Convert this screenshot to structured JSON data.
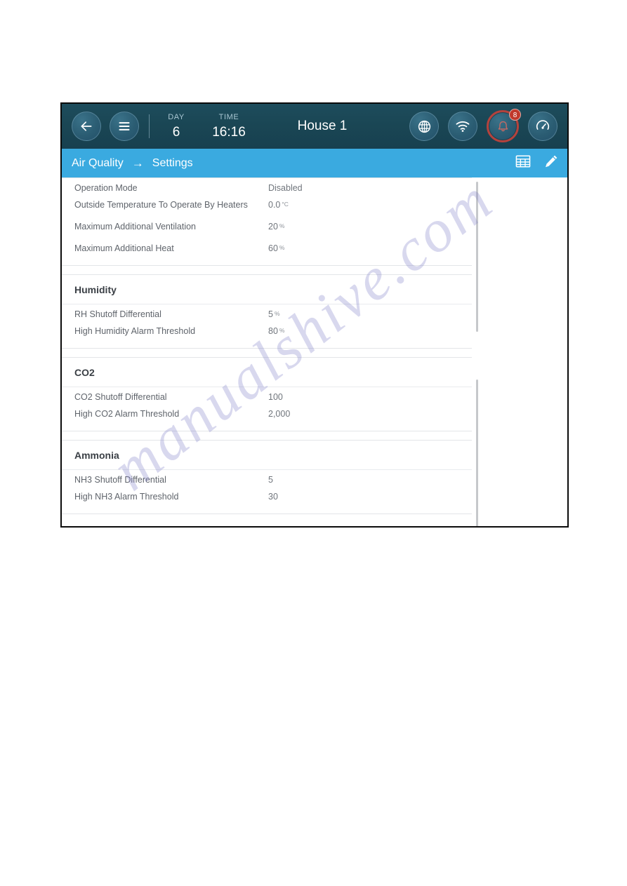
{
  "topbar": {
    "back_icon": "arrow-left-icon",
    "menu_icon": "hamburger-menu-icon",
    "day_label": "DAY",
    "day_value": "6",
    "time_label": "TIME",
    "time_value": "16:16",
    "title": "House 1",
    "globe_icon": "globe-icon",
    "wifi_icon": "wifi-icon",
    "alarm_icon": "alarm-bell-icon",
    "alarm_count": "8",
    "gauge_icon": "gauge-icon",
    "bg_color": "#1a4654",
    "alarm_ring_color": "#b4423d",
    "badge_color": "#c0392b"
  },
  "breadcrumb": {
    "parent": "Air Quality",
    "arrow": "→",
    "current": "Settings",
    "table_icon": "table-grid-icon",
    "edit_icon": "pencil-edit-icon",
    "bg_color": "#3aaae0"
  },
  "sections": [
    {
      "title": null,
      "rows": [
        {
          "label": "Operation Mode",
          "value": "Disabled",
          "unit": ""
        },
        {
          "label": "Outside Temperature To Operate By Heaters",
          "value": "0.0",
          "unit": "°C"
        },
        {
          "label": "Maximum Additional Ventilation",
          "value": "20",
          "unit": "%"
        },
        {
          "label": "Maximum Additional Heat",
          "value": "60",
          "unit": "%"
        }
      ]
    },
    {
      "title": "Humidity",
      "rows": [
        {
          "label": "RH Shutoff Differential",
          "value": "5",
          "unit": "%"
        },
        {
          "label": "High Humidity Alarm Threshold",
          "value": "80",
          "unit": "%"
        }
      ]
    },
    {
      "title": "CO2",
      "rows": [
        {
          "label": "CO2 Shutoff Differential",
          "value": "100",
          "unit": ""
        },
        {
          "label": "High CO2 Alarm Threshold",
          "value": "2,000",
          "unit": ""
        }
      ]
    },
    {
      "title": "Ammonia",
      "rows": [
        {
          "label": "NH3 Shutoff Differential",
          "value": "5",
          "unit": ""
        },
        {
          "label": "High NH3 Alarm Threshold",
          "value": "30",
          "unit": ""
        }
      ]
    }
  ],
  "watermark": {
    "text": "manualshive.com"
  }
}
